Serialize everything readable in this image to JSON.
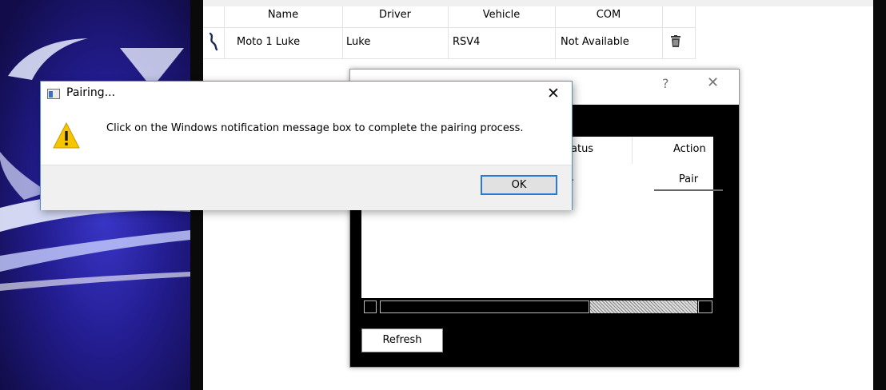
{
  "main_table": {
    "columns": [
      "Name",
      "Driver",
      "Vehicle",
      "COM"
    ],
    "row": {
      "icon": "link-icon",
      "name": "Moto 1 Luke",
      "driver": "Luke",
      "vehicle": "RSV4",
      "com": "Not Available",
      "delete_icon": "trash-icon"
    }
  },
  "background_dialog": {
    "title": "",
    "help_label": "?",
    "close_label": "✕",
    "columns": {
      "status": "atus",
      "action": "Action"
    },
    "row": {
      "status_partial": ".",
      "action_button": "Pair"
    },
    "refresh_label": "Refresh"
  },
  "pairing_dialog": {
    "title": "Pairing...",
    "close_label": "✕",
    "icon": "warning-icon",
    "message": "Click on the Windows notification message box to complete the pairing process.",
    "ok_label": "OK"
  },
  "colors": {
    "brand_dark": "#1a1560",
    "accent_blue": "#2b78d6",
    "dialog_border": "#4a8fd6",
    "warning_yellow": "#f7c500"
  }
}
